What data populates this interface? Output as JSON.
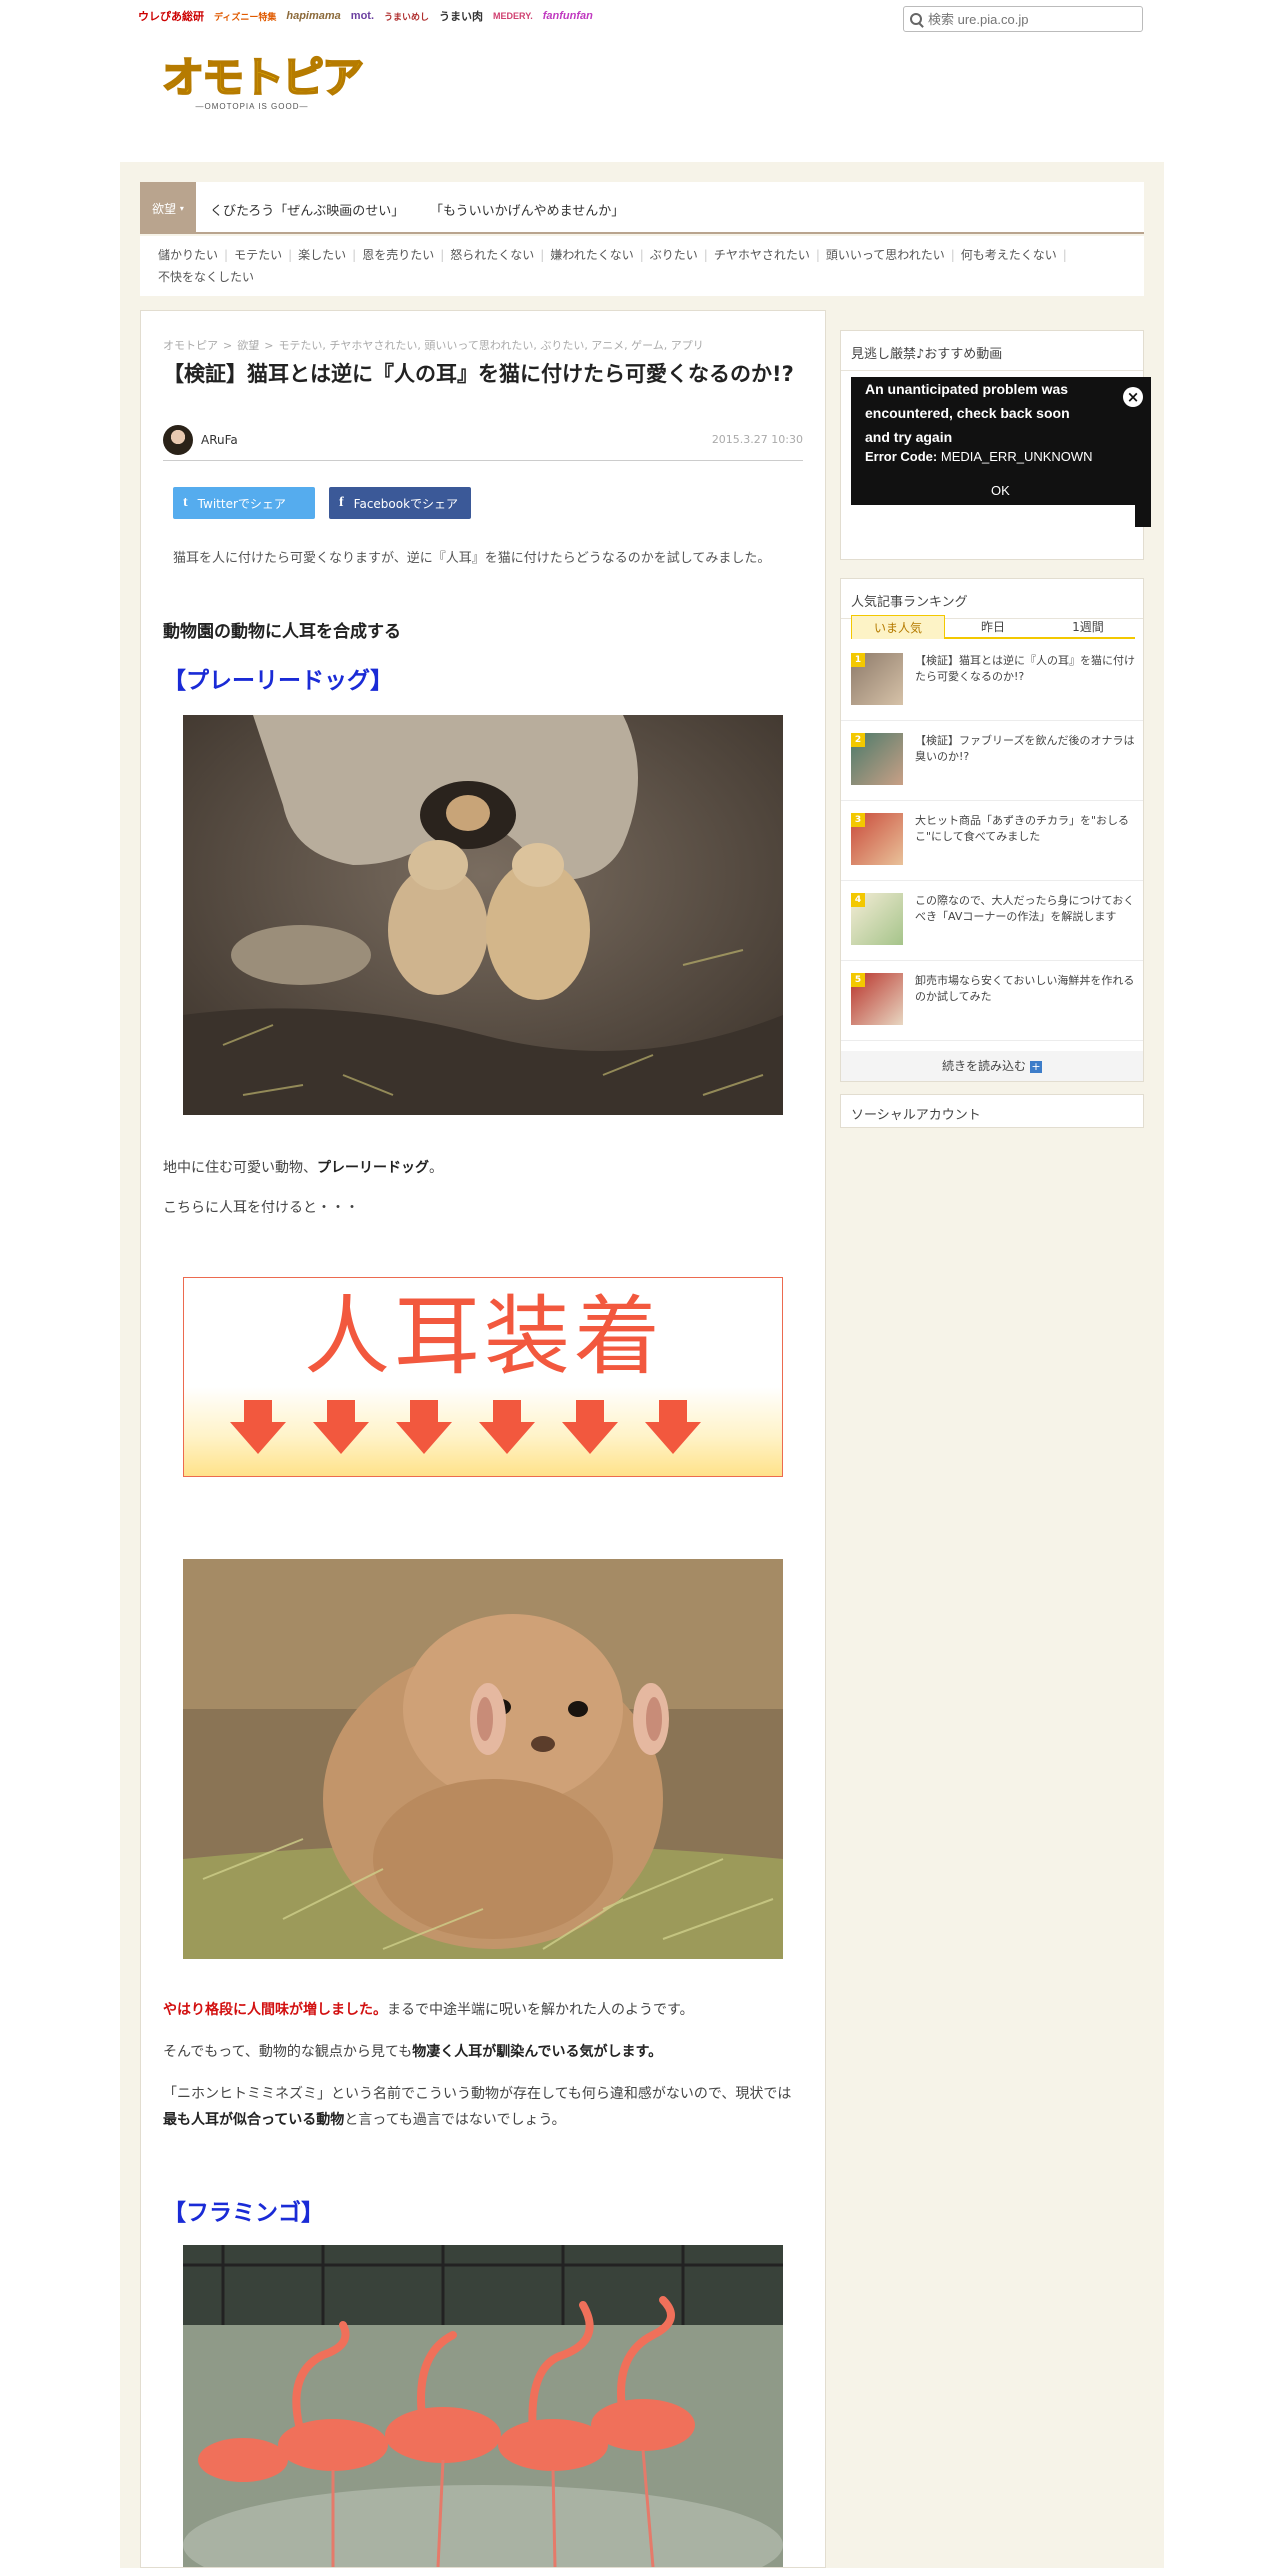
{
  "network": {
    "sites": [
      "ウレぴあ総研",
      "ディズニー特集",
      "hapimama",
      "mot.",
      "うまいめし",
      "うまい肉",
      "MEDERY.",
      "fanfunfan"
    ],
    "search_placeholder": "検索 ure.pia.co.jp"
  },
  "logo": {
    "text": "オモトピア",
    "tagline": "—OMOTOPIA IS GOOD—"
  },
  "category_nav": {
    "active": "欲望",
    "links": [
      "くびたろう「ぜんぶ映画のせい」",
      "「もういいかげんやめませんか」"
    ],
    "subcategories": [
      "儲かりたい",
      "モテたい",
      "楽したい",
      "恩を売りたい",
      "怒られたくない",
      "嫌われたくない",
      "ぶりたい",
      "チヤホヤされたい",
      "頭いいって思われたい",
      "何も考えたくない",
      "不快をなくしたい"
    ]
  },
  "article": {
    "breadcrumb": [
      "オモトピア",
      "欲望",
      "モテたい, チヤホヤされたい, 頭いいって思われたい, ぶりたい, アニメ, ゲーム, アプリ"
    ],
    "title": "【検証】猫耳とは逆に『人の耳』を猫に付けたら可愛くなるのか!?",
    "author": "ARuFa",
    "date": "2015.3.27 10:30",
    "share_twitter": "Twitterでシェア",
    "share_facebook": "Facebookでシェア",
    "lead": "猫耳を人に付けたら可愛くなりますが、逆に『人耳』を猫に付けたらどうなるのかを試してみました。",
    "section_title": "動物園の動物に人耳を合成する",
    "sub1": "【プレーリードッグ】",
    "p1_a": "地中に住む可愛い動物、",
    "p1_b": "プレーリードッグ",
    "p1_c": "。",
    "p2": "こちらに人耳を付けると・・・",
    "banner_text": "人耳装着",
    "p3_red": "やはり格段に人間味が増しました。",
    "p3_rest": "まるで中途半端に呪いを解かれた人のようです。",
    "p4_a": "そんでもって、動物的な観点から見ても",
    "p4_b": "物凄く人耳が馴染んでいる気がします。",
    "p5_a": "「ニホンヒトミミネズミ」という名前でこういう動物が存在しても何ら違和感がないので、現状では",
    "p5_b": "最も人耳が似合っている動物",
    "p5_c": "と言っても過言ではないでしょう。",
    "sub2": "【フラミンゴ】"
  },
  "sidebar": {
    "video_title": "見逃し厳禁♪おすすめ動画",
    "video_error": "An unanticipated problem was encountered, check back soon and try again",
    "video_error_code_label": "Error Code:",
    "video_error_code": "MEDIA_ERR_UNKNOWN",
    "video_ok": "OK",
    "ranking_title": "人気記事ランキング",
    "tabs": [
      "いま人気",
      "昨日",
      "1週間"
    ],
    "ranking": [
      {
        "num": "1",
        "text": "【検証】猫耳とは逆に『人の耳』を猫に付けたら可愛くなるのか!?"
      },
      {
        "num": "2",
        "text": "【検証】ファブリーズを飲んだ後のオナラは臭いのか!?"
      },
      {
        "num": "3",
        "text": "大ヒット商品「あずきのチカラ」を\"おしるこ\"にして食べてみました"
      },
      {
        "num": "4",
        "text": "この際なので、大人だったら身につけておくべき「AVコーナーの作法」を解説します"
      },
      {
        "num": "5",
        "text": "卸売市場なら安くておいしい海鮮丼を作れるのか試してみた"
      }
    ],
    "more_label": "続きを読み込む",
    "social_title": "ソーシャルアカウント"
  }
}
